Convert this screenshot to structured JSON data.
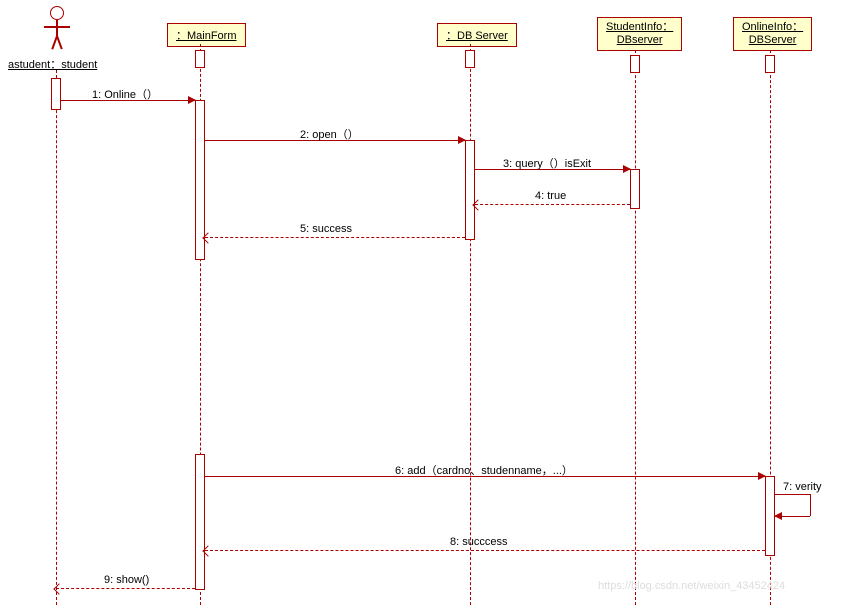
{
  "type": "sequence-diagram",
  "actor": {
    "label": "astudent：student"
  },
  "lifelines": [
    {
      "label": "：MainForm"
    },
    {
      "label": "：DB Server"
    },
    {
      "label": "StudentInfo：DBserver"
    },
    {
      "label": "OnlineInfo：DBServer"
    }
  ],
  "messages": [
    {
      "label": "1: Online（）"
    },
    {
      "label": "2: open（）"
    },
    {
      "label": "3: query（）isExit"
    },
    {
      "label": "4: true"
    },
    {
      "label": "5: success"
    },
    {
      "label": "6: add（cardno、studenname，...）"
    },
    {
      "label": "7: verity"
    },
    {
      "label": "8: succcess"
    },
    {
      "label": "9: show()"
    }
  ],
  "watermark": "https://blog.csdn.net/weixin_43452424",
  "chart_data": {
    "type": "sequence",
    "participants": [
      "astudent",
      "MainForm",
      "DB Server",
      "StudentInfo",
      "OnlineInfo"
    ],
    "events": [
      {
        "from": "astudent",
        "to": "MainForm",
        "kind": "call",
        "text": "1: Online（）"
      },
      {
        "from": "MainForm",
        "to": "DB Server",
        "kind": "call",
        "text": "2: open（）"
      },
      {
        "from": "DB Server",
        "to": "StudentInfo",
        "kind": "call",
        "text": "3: query（）isExit"
      },
      {
        "from": "StudentInfo",
        "to": "DB Server",
        "kind": "return",
        "text": "4: true"
      },
      {
        "from": "DB Server",
        "to": "MainForm",
        "kind": "return",
        "text": "5: success"
      },
      {
        "from": "MainForm",
        "to": "OnlineInfo",
        "kind": "call",
        "text": "6: add（cardno、studenname，...）"
      },
      {
        "from": "OnlineInfo",
        "to": "OnlineInfo",
        "kind": "self",
        "text": "7: verity"
      },
      {
        "from": "OnlineInfo",
        "to": "MainForm",
        "kind": "return",
        "text": "8: succcess"
      },
      {
        "from": "MainForm",
        "to": "astudent",
        "kind": "return",
        "text": "9: show()"
      }
    ]
  }
}
